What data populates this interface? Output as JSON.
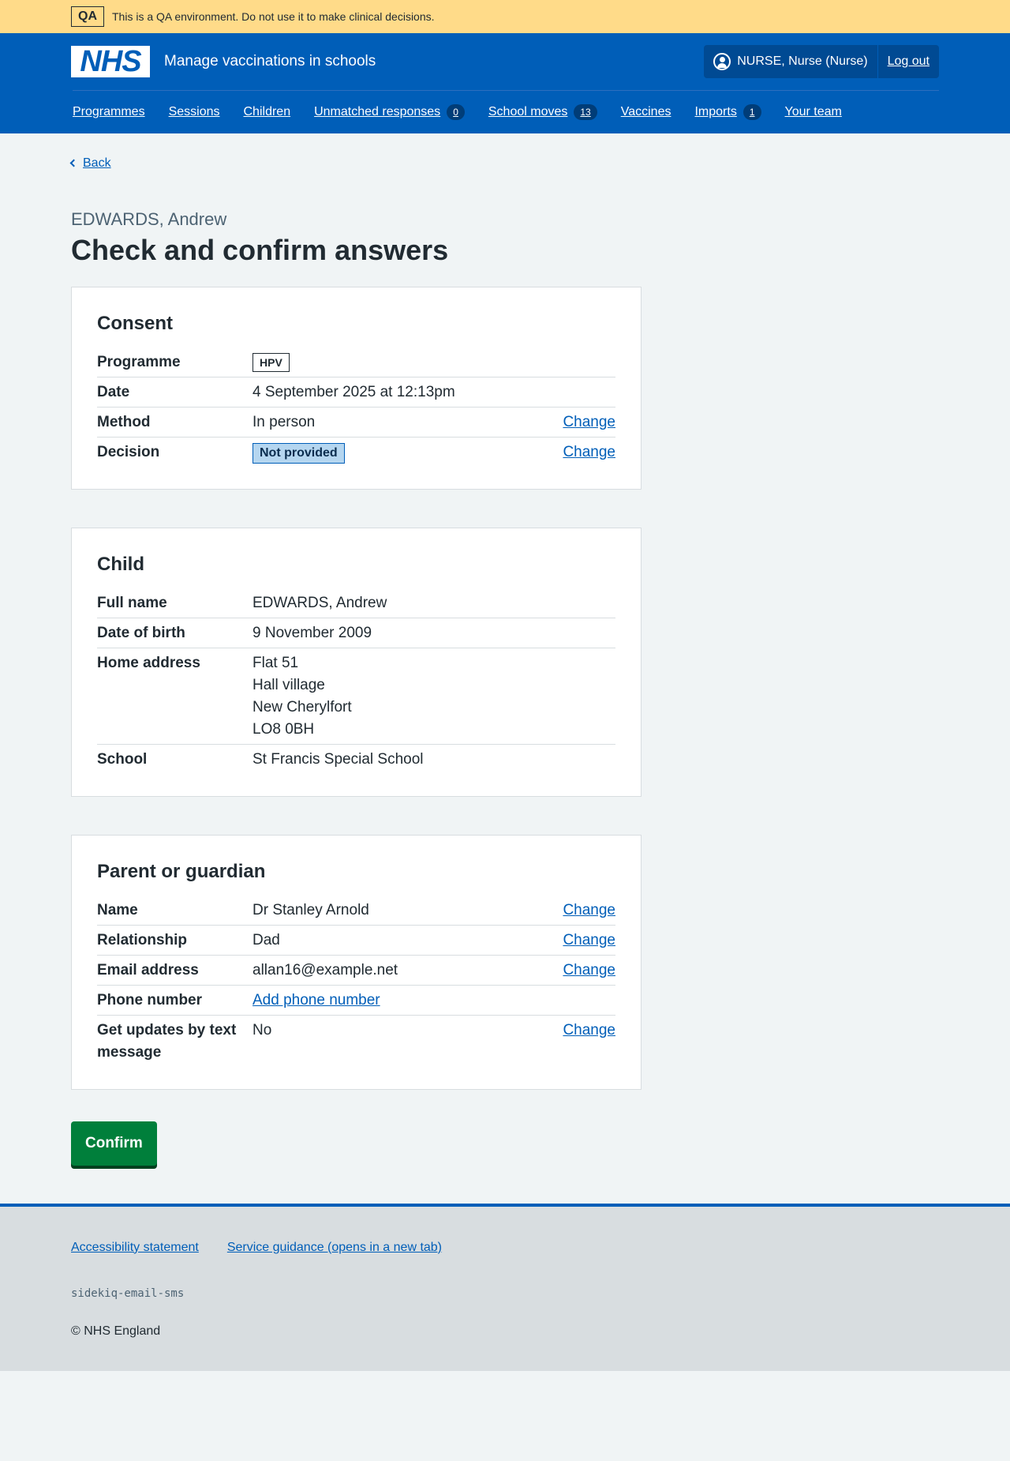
{
  "qa_banner": {
    "tag": "QA",
    "text": "This is a QA environment. Do not use it to make clinical decisions."
  },
  "header": {
    "logo": "NHS",
    "service_name": "Manage vaccinations in schools",
    "user": "NURSE, Nurse (Nurse)",
    "logout": "Log out"
  },
  "nav": {
    "programmes": "Programmes",
    "sessions": "Sessions",
    "children": "Children",
    "unmatched": "Unmatched responses",
    "unmatched_count": "0",
    "school_moves": "School moves",
    "school_moves_count": "13",
    "vaccines": "Vaccines",
    "imports": "Imports",
    "imports_count": "1",
    "your_team": "Your team"
  },
  "back": "Back",
  "caption": "EDWARDS, Andrew",
  "title": "Check and confirm answers",
  "consent": {
    "heading": "Consent",
    "programme_label": "Programme",
    "programme_value": "HPV",
    "date_label": "Date",
    "date_value": "4 September 2025 at 12:13pm",
    "method_label": "Method",
    "method_value": "In person",
    "decision_label": "Decision",
    "decision_value": "Not provided",
    "change": "Change"
  },
  "child": {
    "heading": "Child",
    "fullname_label": "Full name",
    "fullname_value": "EDWARDS, Andrew",
    "dob_label": "Date of birth",
    "dob_value": "9 November 2009",
    "address_label": "Home address",
    "address_line1": "Flat 51",
    "address_line2": "Hall village",
    "address_line3": "New Cherylfort",
    "address_line4": "LO8 0BH",
    "school_label": "School",
    "school_value": "St Francis Special School"
  },
  "parent": {
    "heading": "Parent or guardian",
    "name_label": "Name",
    "name_value": "Dr Stanley Arnold",
    "relationship_label": "Relationship",
    "relationship_value": "Dad",
    "email_label": "Email address",
    "email_value": "allan16@example.net",
    "phone_label": "Phone number",
    "phone_link": "Add phone number",
    "updates_label": "Get updates by text message",
    "updates_value": "No",
    "change": "Change"
  },
  "confirm_button": "Confirm",
  "footer": {
    "accessibility": "Accessibility statement",
    "guidance": "Service guidance (opens in a new tab)",
    "code": "sidekiq-email-sms",
    "copyright": "© NHS England"
  }
}
